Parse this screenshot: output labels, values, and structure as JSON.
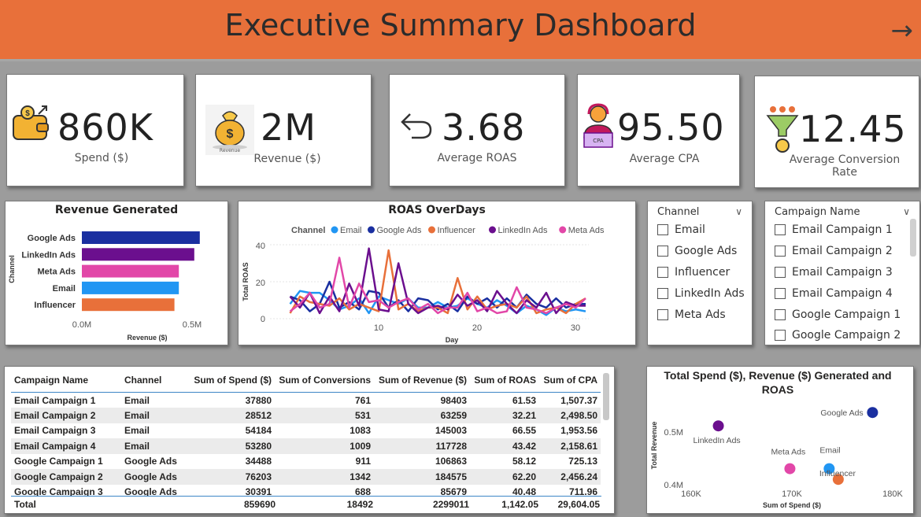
{
  "header": {
    "title": "Executive Summary Dashboard",
    "nav_arrow": "→"
  },
  "kpis": [
    {
      "value": "860K",
      "label": "Spend ($)",
      "icon": "wallet-money-icon"
    },
    {
      "value": "2M",
      "label": "Revenue ($)",
      "icon": "money-bag-icon",
      "icon_caption": "Revenue"
    },
    {
      "value": "3.68",
      "label": "Average ROAS",
      "icon": "return-arrow-icon"
    },
    {
      "value": "95.50",
      "label": "Average CPA",
      "icon": "cpa-person-icon",
      "icon_caption": "CPA"
    },
    {
      "value": "12.45",
      "label": "Average Conversion Rate",
      "icon": "funnel-icon"
    }
  ],
  "colors": {
    "header": "#e8703a",
    "google_ads": "#1a2fa0",
    "linkedin_ads": "#6b0f8e",
    "meta_ads": "#e247a8",
    "email": "#2196f3",
    "influencer": "#e8703a"
  },
  "revenue_chart": {
    "title": "Revenue Generated",
    "y_axis_label": "Channel",
    "x_axis_label": "Revenue ($)",
    "tick_labels": [
      "0.0M",
      "0.5M"
    ]
  },
  "roas_chart": {
    "title": "ROAS OverDays",
    "legend_title": "Channel",
    "y_axis_label": "Total ROAS",
    "x_axis_label": "Day",
    "y_ticks": [
      "0",
      "20",
      "40"
    ],
    "x_ticks": [
      "10",
      "20",
      "30"
    ]
  },
  "scatter_chart": {
    "title_line1": "Total Spend ($), Revenue ($) Generated and",
    "title_line2": "ROAS",
    "x_axis_label": "Sum of Spend ($)",
    "y_axis_label": "Total Revenue",
    "x_ticks": [
      "160K",
      "170K",
      "180K"
    ],
    "y_ticks": [
      "0.4M",
      "0.5M"
    ]
  },
  "channel_slicer": {
    "header": "Channel",
    "items": [
      "Email",
      "Google Ads",
      "Influencer",
      "LinkedIn Ads",
      "Meta Ads"
    ]
  },
  "campaign_slicer": {
    "header": "Campaign Name",
    "items": [
      "Email Campaign 1",
      "Email Campaign 2",
      "Email Campaign 3",
      "Email Campaign 4",
      "Google Campaign 1",
      "Google Campaign 2"
    ]
  },
  "table": {
    "columns": [
      "Campaign Name",
      "Channel",
      "Sum of Spend ($)",
      "Sum of Conversions",
      "Sum of Revenue ($)",
      "Sum of ROAS",
      "Sum of CPA"
    ],
    "rows": [
      [
        "Email Campaign 1",
        "Email",
        "37880",
        "761",
        "98403",
        "61.53",
        "1,507.37"
      ],
      [
        "Email Campaign 2",
        "Email",
        "28512",
        "531",
        "63259",
        "32.21",
        "2,498.50"
      ],
      [
        "Email Campaign 3",
        "Email",
        "54184",
        "1083",
        "145003",
        "66.55",
        "1,953.56"
      ],
      [
        "Email Campaign 4",
        "Email",
        "53280",
        "1009",
        "117728",
        "43.42",
        "2,158.61"
      ],
      [
        "Google Campaign 1",
        "Google Ads",
        "34488",
        "911",
        "106863",
        "58.12",
        "725.13"
      ],
      [
        "Google Campaign 2",
        "Google Ads",
        "76203",
        "1342",
        "184575",
        "62.20",
        "2,456.24"
      ],
      [
        "Google Campaign 3",
        "Google Ads",
        "30391",
        "688",
        "85679",
        "40.48",
        "711.96"
      ]
    ],
    "total": [
      "Total",
      "",
      "859690",
      "18492",
      "2299011",
      "1,142.05",
      "29,604.05"
    ]
  },
  "chart_data": [
    {
      "type": "bar",
      "orientation": "horizontal",
      "title": "Revenue Generated",
      "xlabel": "Revenue ($)",
      "ylabel": "Channel",
      "categories": [
        "Google Ads",
        "LinkedIn Ads",
        "Meta Ads",
        "Email",
        "Influencer"
      ],
      "values": [
        0.535,
        0.51,
        0.44,
        0.44,
        0.42
      ],
      "value_unit": "M",
      "xlim": [
        0,
        0.6
      ]
    },
    {
      "type": "line",
      "title": "ROAS OverDays",
      "xlabel": "Day",
      "ylabel": "Total ROAS",
      "legend_title": "Channel",
      "legend_position": "top",
      "xlim": [
        0,
        32
      ],
      "ylim": [
        0,
        42
      ],
      "x": [
        1,
        2,
        3,
        4,
        5,
        6,
        7,
        8,
        9,
        10,
        11,
        12,
        13,
        14,
        15,
        16,
        17,
        18,
        19,
        20,
        21,
        22,
        23,
        24,
        25,
        26,
        27,
        28,
        29,
        30,
        31
      ],
      "series": [
        {
          "name": "Email",
          "values": [
            8,
            15,
            14,
            14,
            10,
            5,
            7,
            11,
            3,
            12,
            10,
            8,
            11,
            6,
            6,
            9,
            6,
            7,
            11,
            8,
            6,
            10,
            7,
            3,
            7,
            5,
            2,
            6,
            4,
            5,
            4
          ]
        },
        {
          "name": "Google Ads",
          "values": [
            12,
            10,
            4,
            8,
            20,
            6,
            9,
            5,
            15,
            14,
            6,
            10,
            4,
            11,
            10,
            5,
            8,
            4,
            12,
            8,
            11,
            6,
            11,
            6,
            13,
            8,
            6,
            11,
            6,
            8,
            8
          ]
        },
        {
          "name": "Influencer",
          "values": [
            3,
            12,
            9,
            8,
            7,
            11,
            5,
            8,
            6,
            4,
            37,
            5,
            8,
            4,
            6,
            6,
            3,
            22,
            5,
            12,
            5,
            7,
            8,
            6,
            12,
            3,
            5,
            6,
            3,
            8,
            11
          ]
        },
        {
          "name": "LinkedIn Ads",
          "values": [
            12,
            6,
            14,
            3,
            12,
            4,
            19,
            7,
            38,
            5,
            4,
            30,
            8,
            3,
            6,
            7,
            5,
            13,
            7,
            10,
            4,
            15,
            8,
            3,
            10,
            6,
            14,
            3,
            9,
            7,
            7
          ]
        },
        {
          "name": "Meta Ads",
          "values": [
            4,
            8,
            14,
            6,
            8,
            33,
            6,
            19,
            9,
            10,
            6,
            9,
            11,
            5,
            8,
            3,
            6,
            6,
            14,
            4,
            6,
            3,
            4,
            17,
            6,
            5,
            3,
            6,
            8,
            6,
            11
          ]
        }
      ]
    },
    {
      "type": "scatter",
      "title": "Total Spend ($), Revenue ($) Generated and ROAS",
      "xlabel": "Sum of Spend ($)",
      "ylabel": "Total Revenue",
      "xlim": [
        160000,
        180000
      ],
      "ylim": [
        0.39,
        0.55
      ],
      "points": [
        {
          "label": "Google Ads",
          "x": 178000,
          "y": 0.535
        },
        {
          "label": "LinkedIn Ads",
          "x": 162700,
          "y": 0.51
        },
        {
          "label": "Meta Ads",
          "x": 169800,
          "y": 0.43
        },
        {
          "label": "Email",
          "x": 173700,
          "y": 0.43
        },
        {
          "label": "Influencer",
          "x": 174600,
          "y": 0.41
        }
      ]
    }
  ]
}
